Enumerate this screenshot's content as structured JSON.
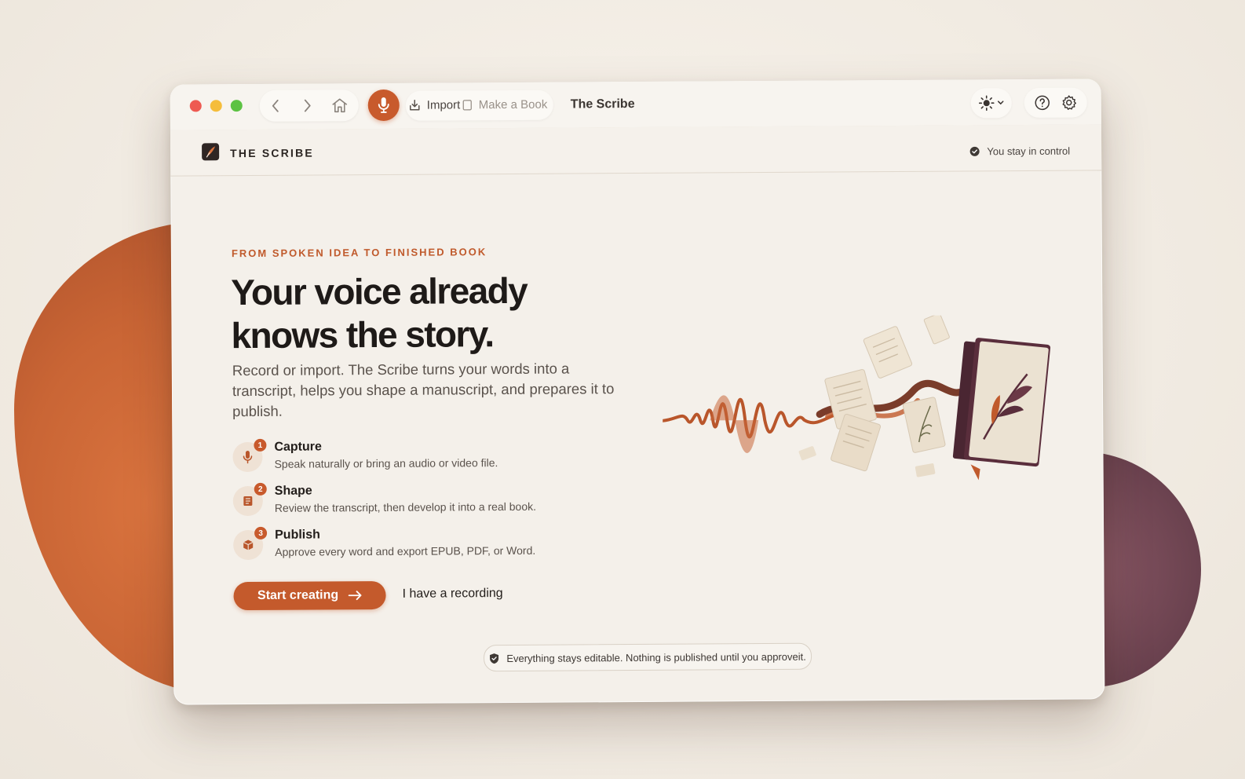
{
  "window": {
    "title": "The Scribe"
  },
  "toolbar": {
    "import_label": "Import",
    "make_book_label": "Make a Book"
  },
  "appbar": {
    "brand": "THE SCRIBE",
    "control_text": "You stay in control"
  },
  "hero": {
    "eyebrow": "FROM SPOKEN IDEA TO FINISHED BOOK",
    "headline": "Your voice already knows the story.",
    "lede": "Record or import. The Scribe turns your words into a transcript, helps you shape a manuscript, and prepares it to publish."
  },
  "steps": [
    {
      "number": "1",
      "title": "Capture",
      "description": "Speak naturally or bring an audio or video file.",
      "icon": "microphone-icon"
    },
    {
      "number": "2",
      "title": "Shape",
      "description": "Review the transcript, then develop it into a real book.",
      "icon": "book-icon"
    },
    {
      "number": "3",
      "title": "Publish",
      "description": "Approve every word and export EPUB, PDF, or Word.",
      "icon": "package-icon"
    }
  ],
  "actions": {
    "primary_label": "Start creating",
    "secondary_label": "I have a recording"
  },
  "footer": {
    "note": "Everything stays editable. Nothing is published until you approveit."
  },
  "colors": {
    "accent": "#c85a2c",
    "background": "#f4f0ea",
    "blob_left": "#c96535",
    "blob_right": "#6f4552"
  }
}
